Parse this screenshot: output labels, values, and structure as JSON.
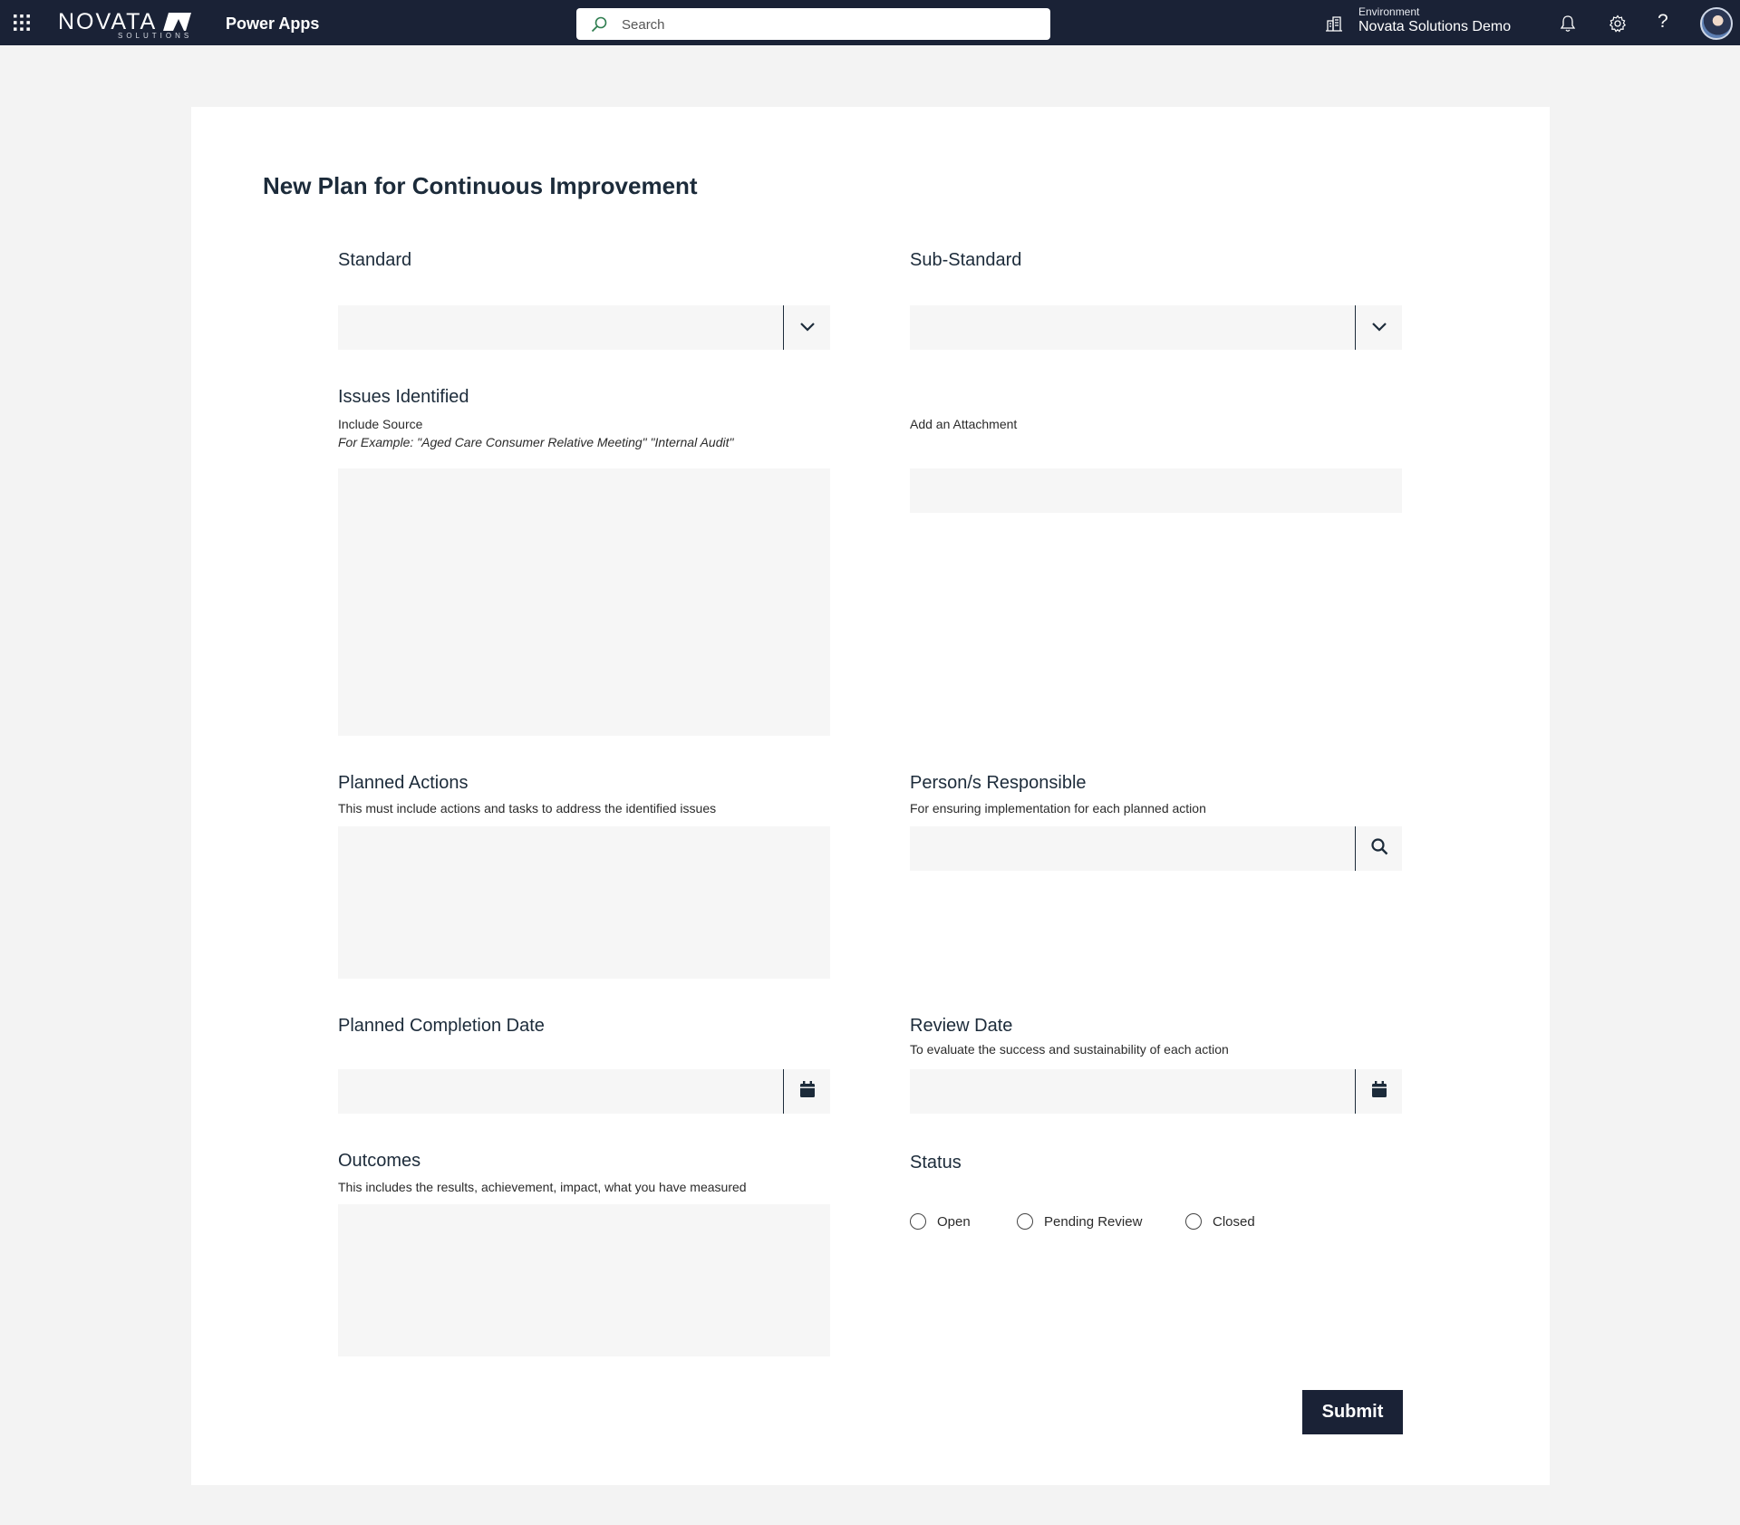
{
  "header": {
    "logo_text": "NOVATA",
    "logo_subtext": "SOLUTIONS",
    "app_name": "Power Apps",
    "search_placeholder": "Search",
    "environment_label": "Environment",
    "environment_name": "Novata Solutions Demo",
    "help_glyph": "?",
    "icons": [
      "waffle-icon",
      "search-icon",
      "environment-icon",
      "bell-icon",
      "gear-icon",
      "help-icon",
      "avatar"
    ]
  },
  "form": {
    "title": "New Plan for Continuous Improvement",
    "standard": {
      "label": "Standard",
      "value": ""
    },
    "sub_standard": {
      "label": "Sub-Standard",
      "value": ""
    },
    "issues": {
      "label": "Issues Identified",
      "hint1": "Include Source",
      "hint2": "For Example: \"Aged Care Consumer Relative Meeting\" \"Internal Audit\"",
      "value": ""
    },
    "attachment": {
      "label": "Add an Attachment"
    },
    "planned_actions": {
      "label": "Planned Actions",
      "hint": "This must include actions and tasks to address the identified issues",
      "value": ""
    },
    "persons": {
      "label": "Person/s Responsible",
      "hint": "For ensuring implementation for each planned action",
      "value": ""
    },
    "completion_date": {
      "label": "Planned Completion Date",
      "value": ""
    },
    "review_date": {
      "label": "Review Date",
      "hint": "To evaluate the success and sustainability of each action",
      "value": ""
    },
    "outcomes": {
      "label": "Outcomes",
      "hint": "This includes the results, achievement, impact, what you have measured",
      "value": ""
    },
    "status": {
      "label": "Status",
      "options": [
        "Open",
        "Pending Review",
        "Closed"
      ],
      "selected": null
    },
    "submit_label": "Submit"
  },
  "colors": {
    "topbar": "#1a2236",
    "page_bg": "#f3f3f3",
    "field_bg": "#f6f6f6",
    "text": "#1c2b3a",
    "button": "#1a2236"
  }
}
